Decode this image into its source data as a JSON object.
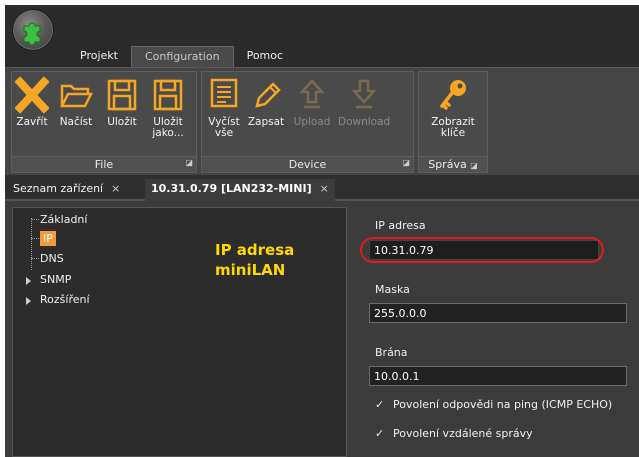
{
  "menu": {
    "tabs": [
      {
        "label": "Projekt",
        "active": false
      },
      {
        "label": "Configuration",
        "active": true
      },
      {
        "label": "Pomoc",
        "active": false
      }
    ]
  },
  "ribbon": {
    "groups": {
      "file": {
        "label": "File",
        "buttons": {
          "close": {
            "label": "Zavřít",
            "icon": "close-icon"
          },
          "load": {
            "label": "Načíst",
            "icon": "folder-open-icon"
          },
          "save": {
            "label": "Uložit",
            "icon": "save-icon"
          },
          "save_as": {
            "label": "Uložit\njako...",
            "icon": "save-as-icon"
          }
        }
      },
      "device": {
        "label": "Device",
        "buttons": {
          "read_all": {
            "label": "Vyčíst\nvše",
            "icon": "read-all-icon"
          },
          "write": {
            "label": "Zapsat",
            "icon": "pencil-icon"
          },
          "upload": {
            "label": "Upload",
            "icon": "upload-icon",
            "disabled": true
          },
          "download": {
            "label": "Download",
            "icon": "download-icon",
            "disabled": true
          }
        }
      },
      "manage": {
        "label": "Správa",
        "buttons": {
          "show_keys": {
            "label": "Zobrazit\nklíče",
            "icon": "key-icon"
          }
        }
      }
    }
  },
  "doc_tabs": [
    {
      "label": "Seznam zařízení",
      "close": "×",
      "active": false
    },
    {
      "label": "10.31.0.79 [LAN232-MINI]",
      "close": "×",
      "active": true
    }
  ],
  "tree": {
    "items": {
      "basic": "Základní",
      "ip": "IP",
      "dns": "DNS",
      "snmp": "SNMP",
      "extensions": "Rozšíření"
    },
    "selected": "IP"
  },
  "annotation": {
    "line1": "IP adresa",
    "line2": "miniLAN",
    "color": "#ffd800"
  },
  "form": {
    "ip": {
      "label": "IP adresa",
      "value": "10.31.0.79"
    },
    "mask": {
      "label": "Maska",
      "value": "255.0.0.0"
    },
    "gateway": {
      "label": "Brána",
      "value": "10.0.0.1"
    },
    "ping": {
      "label": "Povolení odpovědi na ping (ICMP ECHO)",
      "checked": true,
      "mark": "✓"
    },
    "remote": {
      "label": "Povolení vzdálené správy",
      "checked": true,
      "mark": "✓"
    }
  },
  "colors": {
    "accent_orange": "#f39a3a",
    "highlight_red": "#e01b1b",
    "icon_orange": "#f5a623"
  }
}
